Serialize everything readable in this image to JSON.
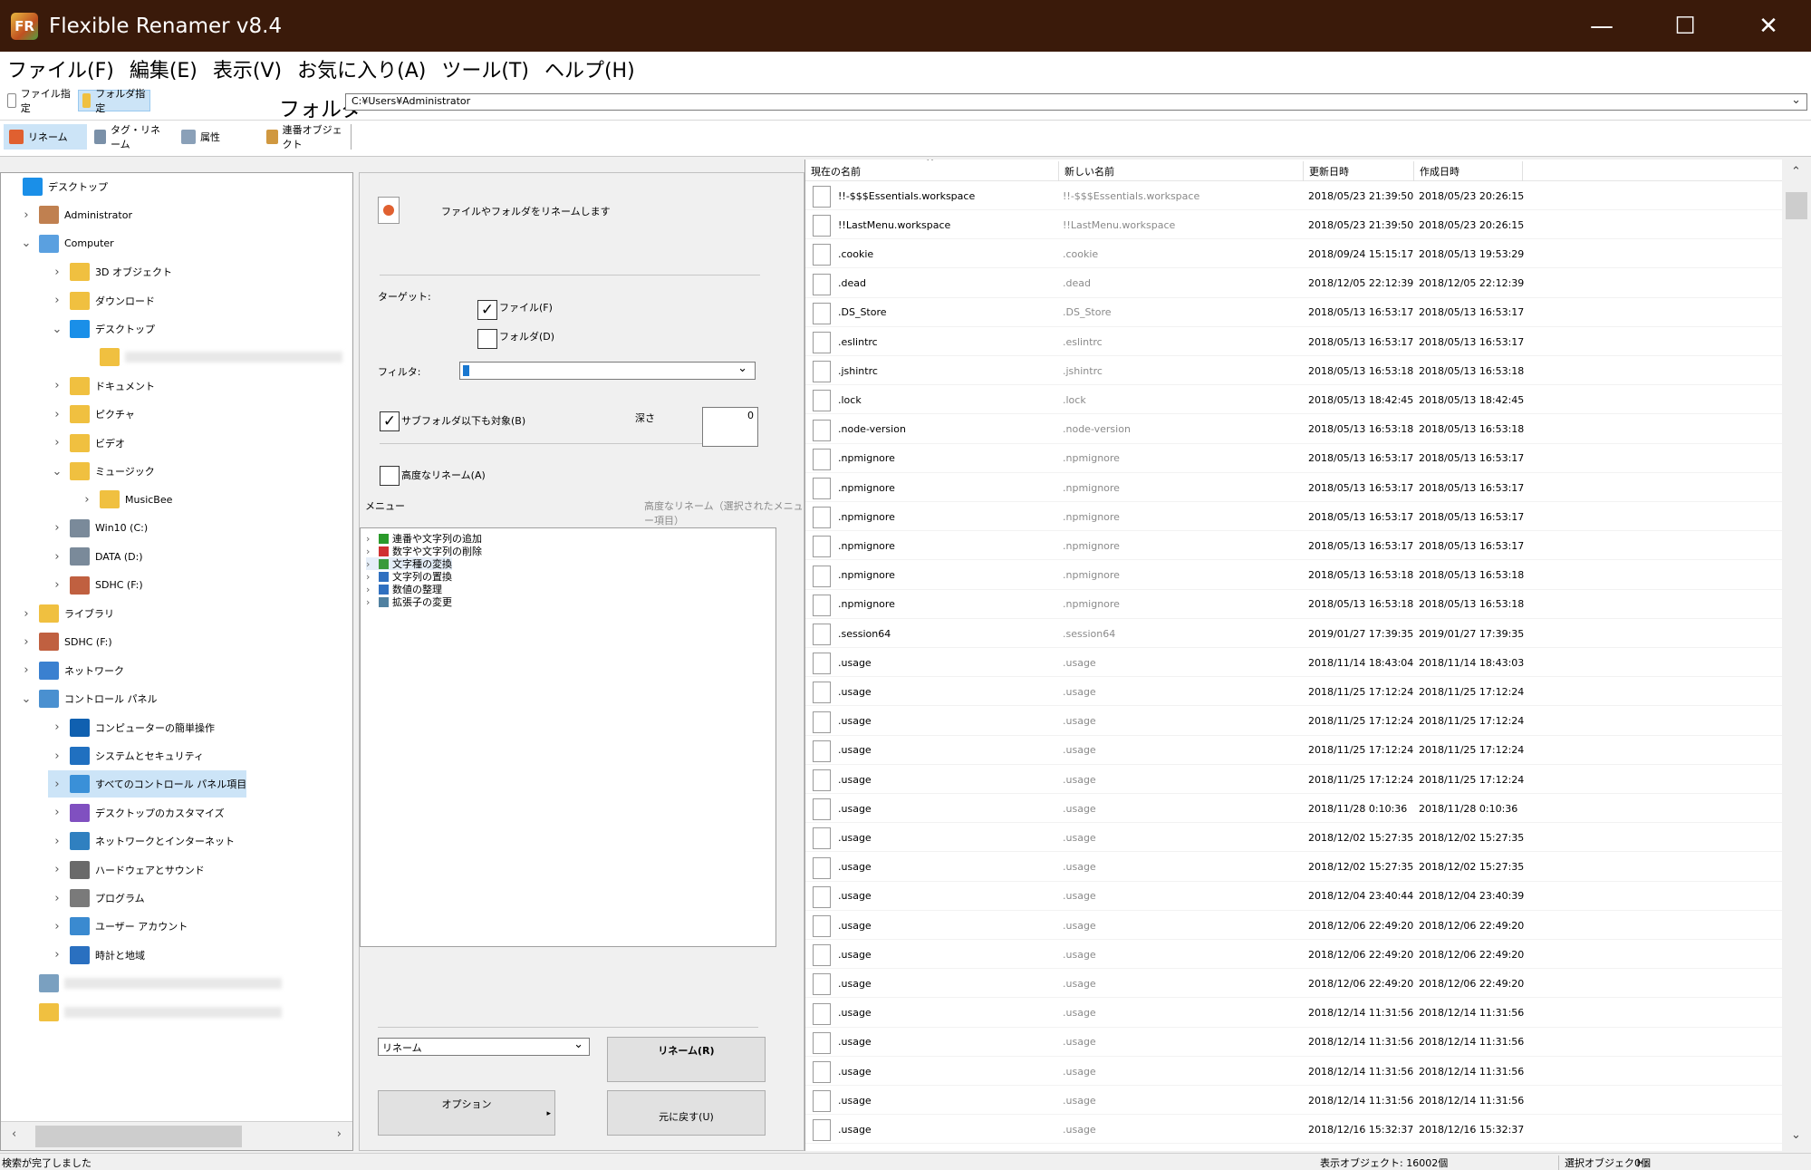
{
  "window": {
    "title": "Flexible Renamer v8.4",
    "logo_text": "FR"
  },
  "menu": [
    "ファイル(F)",
    "編集(E)",
    "表示(V)",
    "お気に入り(A)",
    "ツール(T)",
    "ヘルプ(H)"
  ],
  "mode_tabs": [
    "ファイル指定",
    "フォルダ指定"
  ],
  "folder": {
    "label": "フォルダ",
    "path": "C:¥Users¥Administrator"
  },
  "op_tabs": [
    "リネーム",
    "タグ・リネーム",
    "属性",
    "連番オブジェクト"
  ],
  "tree": [
    {
      "label": "デスクトップ",
      "chev": "",
      "icon": "#1a8fe8"
    },
    {
      "label": "Administrator",
      "chev": "›",
      "icon": "#c08050"
    },
    {
      "label": "Computer",
      "chev": "⌄",
      "icon": "#5aa0e0"
    },
    {
      "label": "3D オブジェクト",
      "chev": "›",
      "icon": "#f0c040"
    },
    {
      "label": "ダウンロード",
      "chev": "›",
      "icon": "#f0c040"
    },
    {
      "label": "デスクトップ",
      "chev": "⌄",
      "icon": "#1a8fe8"
    },
    {
      "label": "",
      "chev": "",
      "icon": "#f0c040"
    },
    {
      "label": "ドキュメント",
      "chev": "›",
      "icon": "#f0c040"
    },
    {
      "label": "ピクチャ",
      "chev": "›",
      "icon": "#f0c040"
    },
    {
      "label": "ビデオ",
      "chev": "›",
      "icon": "#f0c040"
    },
    {
      "label": "ミュージック",
      "chev": "⌄",
      "icon": "#f0c040"
    },
    {
      "label": "MusicBee",
      "chev": "›",
      "icon": "#f0c040"
    },
    {
      "label": "Win10 (C:)",
      "chev": "›",
      "icon": "#7a8a9a"
    },
    {
      "label": "DATA (D:)",
      "chev": "›",
      "icon": "#7a8a9a"
    },
    {
      "label": "SDHC (F:)",
      "chev": "›",
      "icon": "#c06040"
    },
    {
      "label": "ライブラリ",
      "chev": "›",
      "icon": "#f0c040"
    },
    {
      "label": "SDHC (F:)",
      "chev": "›",
      "icon": "#c06040"
    },
    {
      "label": "ネットワーク",
      "chev": "›",
      "icon": "#3a80d0"
    },
    {
      "label": "コントロール パネル",
      "chev": "⌄",
      "icon": "#4a90d0"
    },
    {
      "label": "コンピューターの簡単操作",
      "chev": "›",
      "icon": "#1060b0"
    },
    {
      "label": "システムとセキュリティ",
      "chev": "›",
      "icon": "#2070c0"
    },
    {
      "label": "すべてのコントロール パネル項目",
      "chev": "›",
      "icon": "#3a90d8"
    },
    {
      "label": "デスクトップのカスタマイズ",
      "chev": "›",
      "icon": "#8050c0"
    },
    {
      "label": "ネットワークとインターネット",
      "chev": "›",
      "icon": "#3080c0"
    },
    {
      "label": "ハードウェアとサウンド",
      "chev": "›",
      "icon": "#6a6a6a"
    },
    {
      "label": "プログラム",
      "chev": "›",
      "icon": "#7a7a7a"
    },
    {
      "label": "ユーザー アカウント",
      "chev": "›",
      "icon": "#3a8ad0"
    },
    {
      "label": "時計と地域",
      "chev": "›",
      "icon": "#2a70c0"
    },
    {
      "label": "",
      "chev": "",
      "icon": "#7aa0c0"
    },
    {
      "label": "",
      "chev": "",
      "icon": "#f0c040"
    }
  ],
  "rename_panel": {
    "description": "ファイルやフォルダをリネームします",
    "target_label": "ターゲット:",
    "file_check": "ファイル(F)",
    "folder_check": "フォルダ(D)",
    "filter_label": "フィルタ:",
    "subfolder_check": "サブフォルダ以下も対象(B)",
    "depth_label": "深さ",
    "depth_value": "0",
    "advanced_check": "高度なリネーム(A)",
    "menu_label": "メニュー",
    "menu_hint": "高度なリネーム（選択されたメニュー項目）",
    "menu_items": [
      {
        "label": "連番や文字列の追加",
        "color": "#2a9a2a"
      },
      {
        "label": "数字や文字列の削除",
        "color": "#d03030"
      },
      {
        "label": "文字種の変換",
        "color": "#3a9a3a"
      },
      {
        "label": "文字列の置換",
        "color": "#3070c0"
      },
      {
        "label": "数値の整理",
        "color": "#3070c0"
      },
      {
        "label": "拡張子の変更",
        "color": "#5080a0"
      }
    ],
    "mode_select": "リネーム",
    "rename_button": "リネーム(R)",
    "option_button": "オプション",
    "undo_button": "元に戻す(U)"
  },
  "file_list": {
    "columns": [
      "現在の名前",
      "新しい名前",
      "更新日時",
      "作成日時"
    ],
    "rows": [
      [
        "!!-$$$Essentials.workspace",
        "!!-$$$Essentials.workspace",
        "2018/05/23 21:39:50",
        "2018/05/23 20:26:15"
      ],
      [
        "!!LastMenu.workspace",
        "!!LastMenu.workspace",
        "2018/05/23 21:39:50",
        "2018/05/23 20:26:15"
      ],
      [
        ".cookie",
        ".cookie",
        "2018/09/24 15:15:17",
        "2018/05/13 19:53:29"
      ],
      [
        ".dead",
        ".dead",
        "2018/12/05 22:12:39",
        "2018/12/05 22:12:39"
      ],
      [
        ".DS_Store",
        ".DS_Store",
        "2018/05/13 16:53:17",
        "2018/05/13 16:53:17"
      ],
      [
        ".eslintrc",
        ".eslintrc",
        "2018/05/13 16:53:17",
        "2018/05/13 16:53:17"
      ],
      [
        ".jshintrc",
        ".jshintrc",
        "2018/05/13 16:53:18",
        "2018/05/13 16:53:18"
      ],
      [
        ".lock",
        ".lock",
        "2018/05/13 18:42:45",
        "2018/05/13 18:42:45"
      ],
      [
        ".node-version",
        ".node-version",
        "2018/05/13 16:53:18",
        "2018/05/13 16:53:18"
      ],
      [
        ".npmignore",
        ".npmignore",
        "2018/05/13 16:53:17",
        "2018/05/13 16:53:17"
      ],
      [
        ".npmignore",
        ".npmignore",
        "2018/05/13 16:53:17",
        "2018/05/13 16:53:17"
      ],
      [
        ".npmignore",
        ".npmignore",
        "2018/05/13 16:53:17",
        "2018/05/13 16:53:17"
      ],
      [
        ".npmignore",
        ".npmignore",
        "2018/05/13 16:53:17",
        "2018/05/13 16:53:17"
      ],
      [
        ".npmignore",
        ".npmignore",
        "2018/05/13 16:53:18",
        "2018/05/13 16:53:18"
      ],
      [
        ".npmignore",
        ".npmignore",
        "2018/05/13 16:53:18",
        "2018/05/13 16:53:18"
      ],
      [
        ".session64",
        ".session64",
        "2019/01/27 17:39:35",
        "2019/01/27 17:39:35"
      ],
      [
        ".usage",
        ".usage",
        "2018/11/14 18:43:04",
        "2018/11/14 18:43:03"
      ],
      [
        ".usage",
        ".usage",
        "2018/11/25 17:12:24",
        "2018/11/25 17:12:24"
      ],
      [
        ".usage",
        ".usage",
        "2018/11/25 17:12:24",
        "2018/11/25 17:12:24"
      ],
      [
        ".usage",
        ".usage",
        "2018/11/25 17:12:24",
        "2018/11/25 17:12:24"
      ],
      [
        ".usage",
        ".usage",
        "2018/11/25 17:12:24",
        "2018/11/25 17:12:24"
      ],
      [
        ".usage",
        ".usage",
        "2018/11/28 0:10:36",
        "2018/11/28 0:10:36"
      ],
      [
        ".usage",
        ".usage",
        "2018/12/02 15:27:35",
        "2018/12/02 15:27:35"
      ],
      [
        ".usage",
        ".usage",
        "2018/12/02 15:27:35",
        "2018/12/02 15:27:35"
      ],
      [
        ".usage",
        ".usage",
        "2018/12/04 23:40:44",
        "2018/12/04 23:40:39"
      ],
      [
        ".usage",
        ".usage",
        "2018/12/06 22:49:20",
        "2018/12/06 22:49:20"
      ],
      [
        ".usage",
        ".usage",
        "2018/12/06 22:49:20",
        "2018/12/06 22:49:20"
      ],
      [
        ".usage",
        ".usage",
        "2018/12/06 22:49:20",
        "2018/12/06 22:49:20"
      ],
      [
        ".usage",
        ".usage",
        "2018/12/14 11:31:56",
        "2018/12/14 11:31:56"
      ],
      [
        ".usage",
        ".usage",
        "2018/12/14 11:31:56",
        "2018/12/14 11:31:56"
      ],
      [
        ".usage",
        ".usage",
        "2018/12/14 11:31:56",
        "2018/12/14 11:31:56"
      ],
      [
        ".usage",
        ".usage",
        "2018/12/14 11:31:56",
        "2018/12/14 11:31:56"
      ],
      [
        ".usage",
        ".usage",
        "2018/12/16 15:32:37",
        "2018/12/16 15:32:37"
      ]
    ]
  },
  "status": {
    "message": "検索が完了しました",
    "display_objects": "表示オブジェクト: 16002個",
    "selected_label": "選択オブジェクト:",
    "selected_value": "0個"
  },
  "icons": {
    "minimize": "minimize-icon",
    "maximize": "maximize-icon",
    "close": "close-icon",
    "tree_chevron": "chevron-icon",
    "file": "file-icon",
    "folder": "folder-icon"
  },
  "colors": {
    "titlebar": "#3a1a0a",
    "selection": "#cce4f7",
    "accent": "#1a8fe8"
  }
}
